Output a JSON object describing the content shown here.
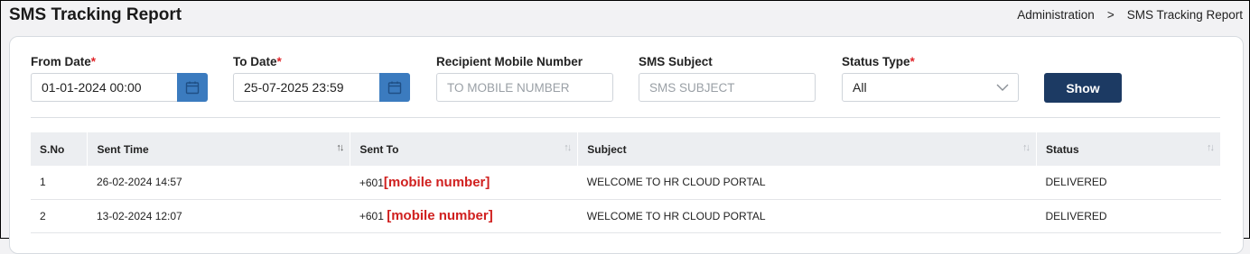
{
  "header": {
    "title": "SMS Tracking Report",
    "breadcrumb": [
      "Administration",
      ">",
      "SMS Tracking Report"
    ]
  },
  "filters": {
    "from_date": {
      "label": "From Date",
      "required_mark": "*",
      "value": "01-01-2024 00:00"
    },
    "to_date": {
      "label": "To Date",
      "required_mark": "*",
      "value": "25-07-2025 23:59"
    },
    "recipient": {
      "label": "Recipient Mobile Number",
      "placeholder": "TO MOBILE NUMBER"
    },
    "subject": {
      "label": "SMS Subject",
      "placeholder": "SMS SUBJECT"
    },
    "status_type": {
      "label": "Status Type",
      "required_mark": "*",
      "selected": "All"
    },
    "show_label": "Show"
  },
  "table": {
    "columns": [
      "S.No",
      "Sent Time",
      "Sent To",
      "Subject",
      "Status"
    ],
    "rows": [
      {
        "sno": "1",
        "sent_time": "26-02-2024 14:57",
        "sent_to_prefix": "+601",
        "sent_to_masked": "[mobile number]",
        "subject": "WELCOME TO HR CLOUD PORTAL",
        "status": "DELIVERED"
      },
      {
        "sno": "2",
        "sent_time": "13-02-2024 12:07",
        "sent_to_prefix": "+601",
        "sent_to_masked": "[mobile number]",
        "subject": "WELCOME TO HR CLOUD PORTAL",
        "status": "DELIVERED"
      }
    ]
  },
  "colors": {
    "accent_blue": "#3b7bbf",
    "button_navy": "#1c3a63",
    "required_red": "#e0262b",
    "masked_red": "#d0201f"
  },
  "icons": [
    "calendar-icon",
    "chevron-down-icon",
    "sort-icon"
  ]
}
